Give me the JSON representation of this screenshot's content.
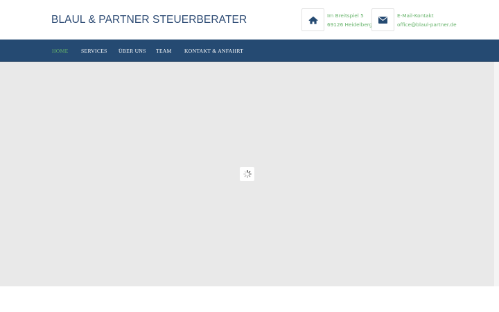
{
  "header": {
    "logo_text": "BLAUL & PARTNER STEUERBERATER",
    "address": {
      "icon": "home-icon",
      "line1": "Im Breitspiel 5",
      "line2": "69126 Heidelberg"
    },
    "email": {
      "icon": "envelope-icon",
      "line1": "E-Mail-Kontakt",
      "line2": "office@blaul-partner.de"
    }
  },
  "nav": {
    "items": [
      {
        "label": "HOME",
        "active": true
      },
      {
        "label": "SERVICES",
        "active": false
      },
      {
        "label": "ÜBER UNS",
        "active": false
      },
      {
        "label": "TEAM",
        "active": false
      },
      {
        "label": "KONTAKT & ANFAHRT",
        "active": false
      }
    ]
  },
  "slider": {
    "loading_icon": "spinner-icon"
  },
  "colors": {
    "brand_blue": "#254a72",
    "logo_blue": "#2c4a73",
    "accent_green": "#66b36a",
    "slider_bg": "#e9e9e9"
  }
}
